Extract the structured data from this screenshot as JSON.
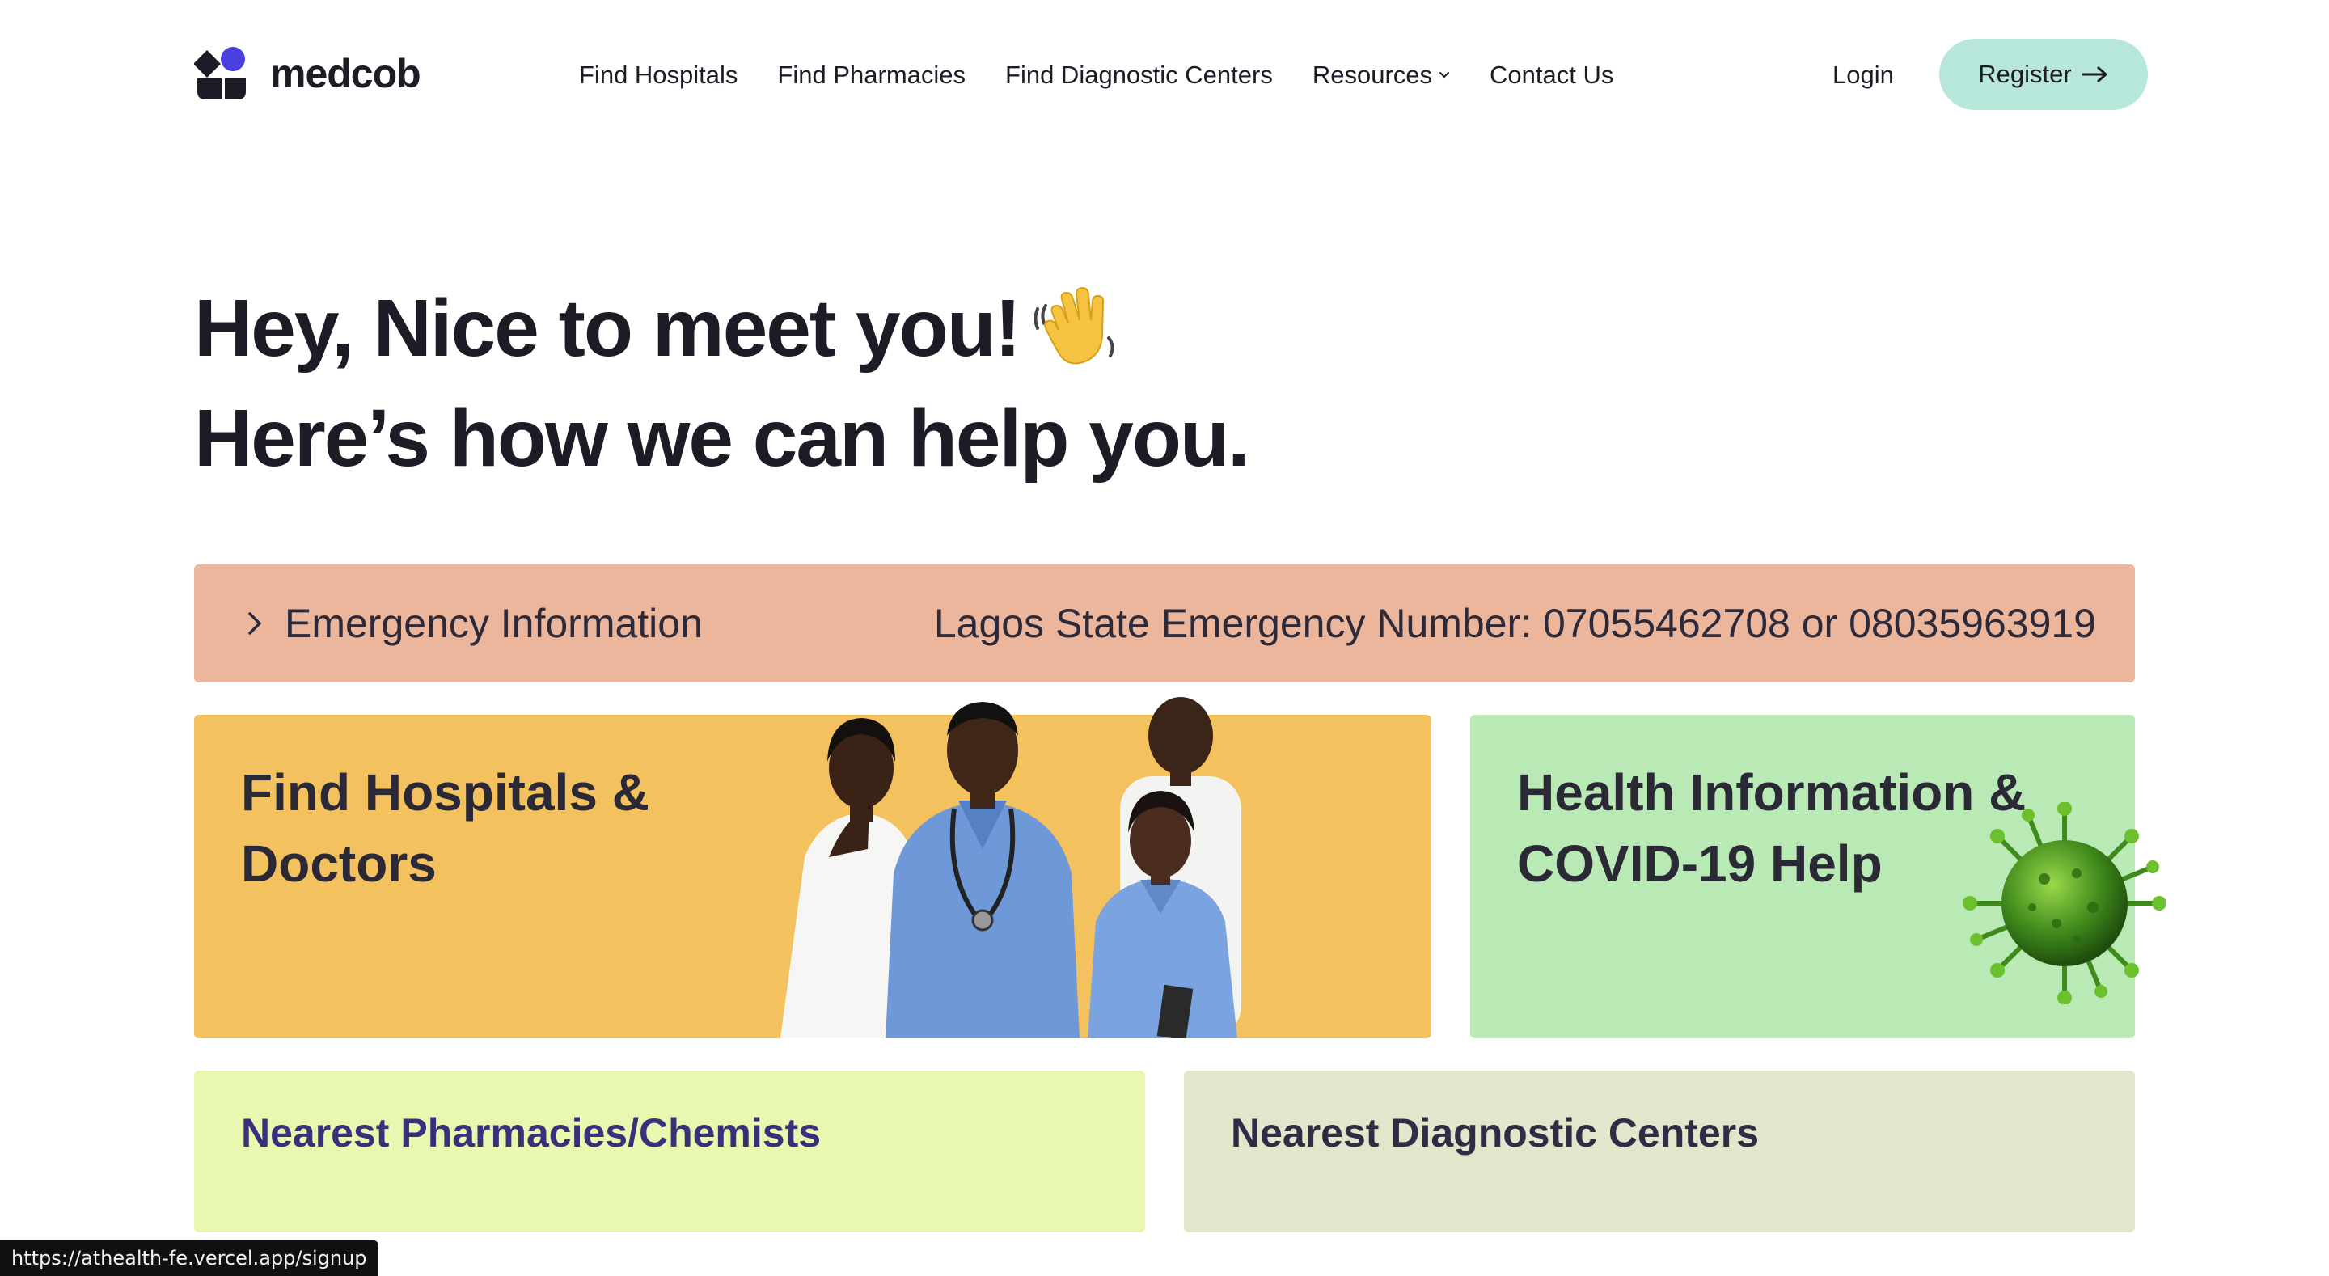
{
  "brand": {
    "name": "medcob",
    "accent": "#b7e6da",
    "logo_colors": [
      "#1d1b26",
      "#4b3fe0"
    ]
  },
  "nav": {
    "items": [
      {
        "label": "Find Hospitals"
      },
      {
        "label": "Find Pharmacies"
      },
      {
        "label": "Find Diagnostic Centers"
      },
      {
        "label": "Resources",
        "icon": "chevron-down-icon"
      },
      {
        "label": "Contact Us"
      }
    ],
    "login_label": "Login",
    "register_label": "Register",
    "register_icon": "arrow-right-icon"
  },
  "hero": {
    "line1": "Hey, Nice to meet you!",
    "line1_icon": "waving-hand-icon",
    "line2": "Here’s how we can help you."
  },
  "emergency": {
    "label": "Emergency Information",
    "icon": "chevron-right-icon",
    "number_text": "Lagos State Emergency Number: 07055462708 or 08035963919",
    "color": "#ebb69b"
  },
  "cards": {
    "hospitals": {
      "title": "Find Hospitals & Doctors",
      "image": "doctors-group-image",
      "color": "#f4c15f"
    },
    "health": {
      "title": "Health Information & COVID-19 Help",
      "image": "virus-image",
      "color": "#b9eab6"
    },
    "pharmacies": {
      "title": "Nearest Pharmacies/Chemists",
      "color": "#e9f8b0"
    },
    "diagnostic": {
      "title": "Nearest Diagnostic Centers",
      "color": "#e4e6cc"
    }
  },
  "status_bar": {
    "url": "https://athealth-fe.vercel.app/signup"
  }
}
